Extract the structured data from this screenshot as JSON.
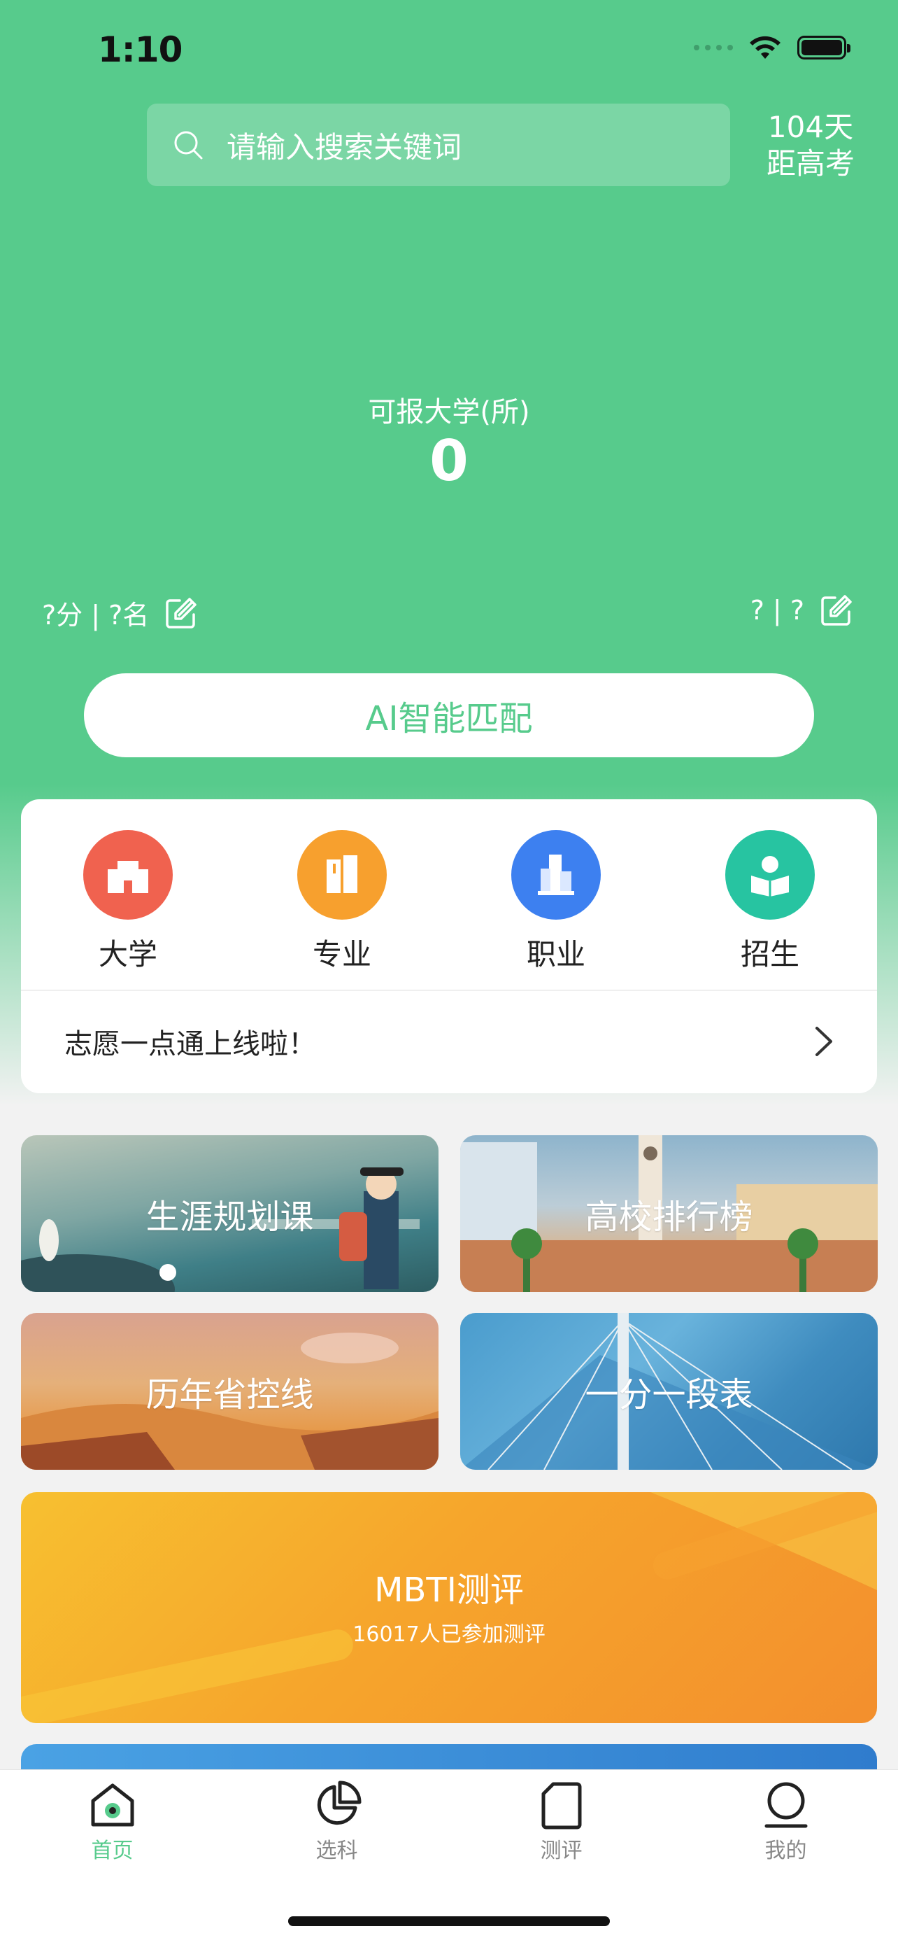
{
  "status_bar": {
    "time": "1:10"
  },
  "search": {
    "placeholder": "请输入搜索关键词"
  },
  "countdown": {
    "days": "104天",
    "label": "距高考"
  },
  "stat": {
    "label": "可报大学(所)",
    "value": "0"
  },
  "score": {
    "left": "?分 | ?名",
    "right": "? | ?"
  },
  "ai_button": {
    "label": "AI智能匹配"
  },
  "quick_links": [
    {
      "label": "大学",
      "color": "#f0624f"
    },
    {
      "label": "专业",
      "color": "#f7a02e"
    },
    {
      "label": "职业",
      "color": "#3d80f0"
    },
    {
      "label": "招生",
      "color": "#27c4a1"
    }
  ],
  "notice": {
    "text": "志愿一点通上线啦！"
  },
  "tiles": {
    "career": "生涯规划课",
    "ranking": "高校排行榜",
    "control_line": "历年省控线",
    "score_table": "一分一段表"
  },
  "mbti": {
    "title": "MBTI测评",
    "subtitle": "16017人已参加测评"
  },
  "tabbar": {
    "items": [
      {
        "label": "首页",
        "icon": "home-icon"
      },
      {
        "label": "选科",
        "icon": "pie-chart-icon"
      },
      {
        "label": "测评",
        "icon": "document-icon"
      },
      {
        "label": "我的",
        "icon": "user-icon"
      }
    ],
    "active_color": "#57cb8c"
  },
  "colors": {
    "brand": "#57cb8c",
    "page_bg": "#f2f2f2"
  }
}
